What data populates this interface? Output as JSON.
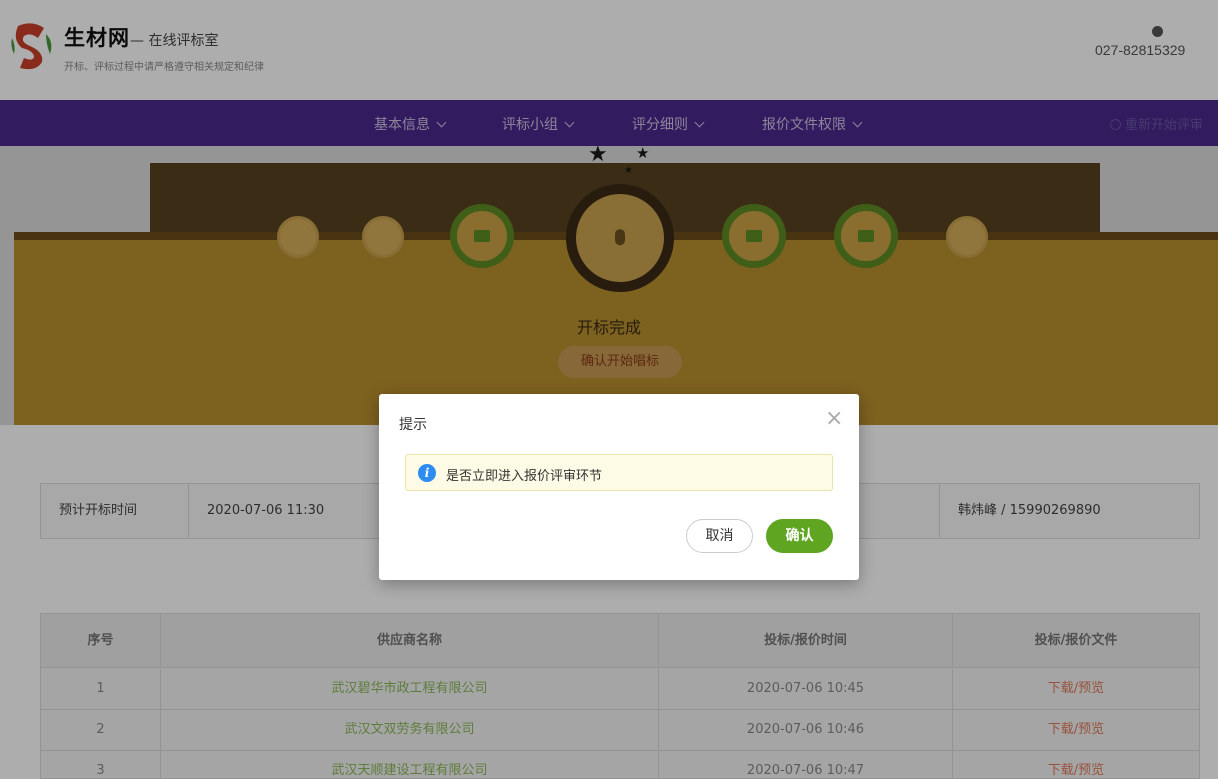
{
  "header": {
    "brand": "生材网",
    "brand_sub": "— 在线评标室",
    "notice": "开标、评标过程中请严格遵守相关规定和纪律",
    "phone": "027-82815329"
  },
  "nav": {
    "items": [
      {
        "label": "基本信息"
      },
      {
        "label": "评标小组"
      },
      {
        "label": "评分细则"
      },
      {
        "label": "报价文件权限"
      }
    ],
    "restart": "重新开始评审"
  },
  "progress": {
    "status": "开标完成",
    "action": "确认开始唱标"
  },
  "info": {
    "label": "预计开标时间",
    "value": "2020-07-06 11:30",
    "contact": "韩炜峰 / 15990269890"
  },
  "table": {
    "headers": [
      "序号",
      "供应商名称",
      "投标/报价时间",
      "投标/报价文件"
    ],
    "rows": [
      [
        "1",
        "武汉碧华市政工程有限公司",
        "2020-07-06 10:45",
        "下载/预览"
      ],
      [
        "2",
        "武汉文双劳务有限公司",
        "2020-07-06 10:46",
        "下载/预览"
      ],
      [
        "3",
        "武汉天顺建设工程有限公司",
        "2020-07-06 10:47",
        "下载/预览"
      ]
    ]
  },
  "dialog": {
    "title": "提示",
    "close_icon": "×",
    "info_icon": "i",
    "message": "是否立即进入报价评审环节",
    "cancel": "取消",
    "confirm": "确认"
  }
}
